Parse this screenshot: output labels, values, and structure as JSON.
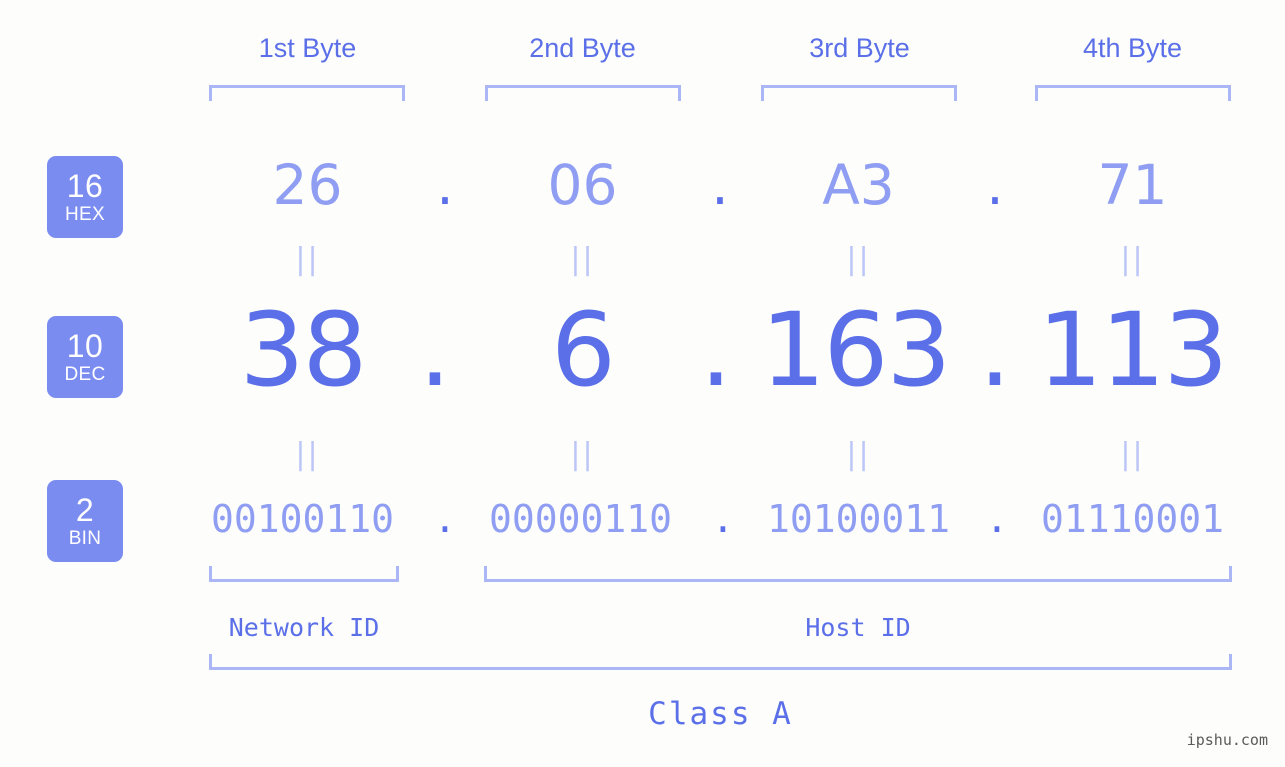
{
  "background_color": "#fdfefb",
  "accent_color": "#5b6fe8",
  "light_color": "#8f9ef2",
  "rule_color": "#aab6f5",
  "badge_color": "#7b8cf0",
  "byte_headers": [
    {
      "label": "1st Byte"
    },
    {
      "label": "2nd Byte"
    },
    {
      "label": "3rd Byte"
    },
    {
      "label": "4th Byte"
    }
  ],
  "radix_rows": [
    {
      "num": "16",
      "name": "HEX"
    },
    {
      "num": "10",
      "name": "DEC"
    },
    {
      "num": "2",
      "name": "BIN"
    }
  ],
  "hex": {
    "bytes": [
      "26",
      "06",
      "A3",
      "71"
    ],
    "separator": "."
  },
  "dec": {
    "bytes": [
      "38",
      "6",
      "163",
      "113"
    ],
    "separator": "."
  },
  "bin": {
    "bytes": [
      "00100110",
      "00000110",
      "10100011",
      "01110001"
    ],
    "separator": "."
  },
  "equality_mark": "||",
  "sections": {
    "network_id": "Network ID",
    "host_id": "Host ID",
    "class": "Class A"
  },
  "watermark": "ipshu.com"
}
